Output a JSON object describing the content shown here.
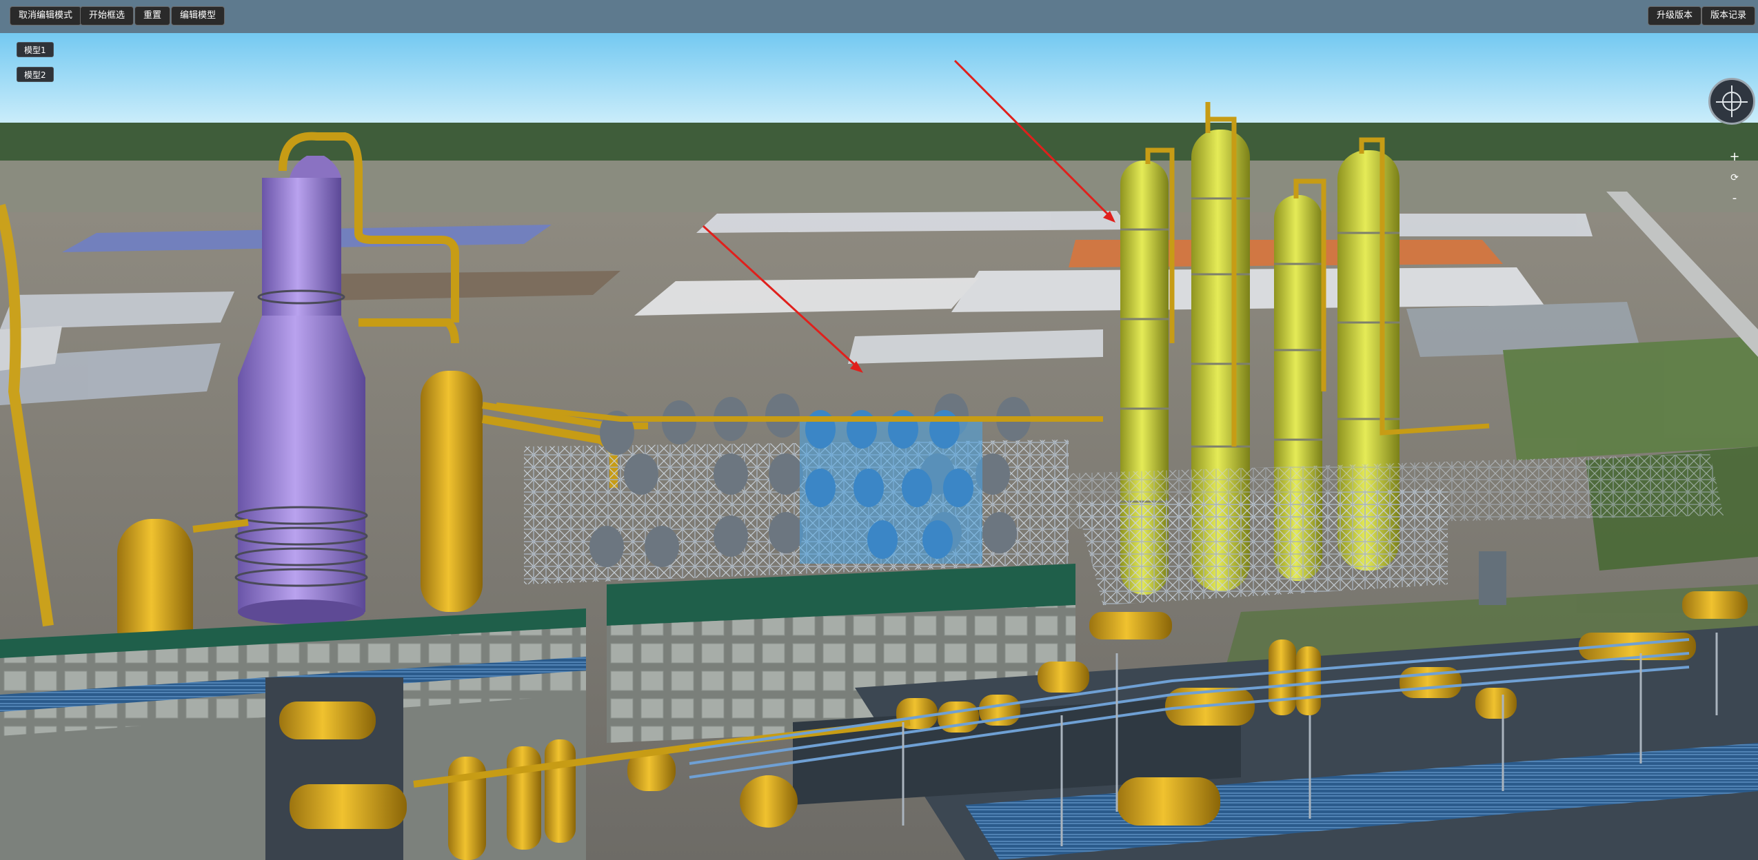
{
  "toolbar": {
    "left_buttons": [
      "取消编辑模式",
      "开始框选",
      "重置",
      "编辑模型"
    ],
    "right_buttons": [
      "升级版本",
      "版本记录"
    ]
  },
  "models": [
    "模型1",
    "模型2"
  ],
  "nav": {
    "zoom_in": "+",
    "reset": "⟳",
    "zoom_out": "-"
  },
  "icons": [
    "compass-icon",
    "zoom-in-icon",
    "reset-view-icon",
    "zoom-out-icon"
  ],
  "colors": {
    "toolbar_bg": "#5e7a8e",
    "sky": "#89d2f4",
    "distillation_column": "#c9cf3a",
    "vessel": "#d6a51b",
    "purple_tower": "#9a7fd1",
    "selection": "#4aa6e8",
    "arrow": "#e0201c"
  }
}
